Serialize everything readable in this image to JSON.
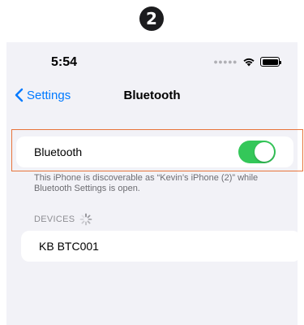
{
  "step_number": "2",
  "status_bar": {
    "time": "5:54",
    "signal_icon": "signal-dots-icon",
    "wifi_icon": "wifi-icon",
    "battery_icon": "battery-icon"
  },
  "nav": {
    "back_label": "Settings",
    "title": "Bluetooth"
  },
  "bluetooth": {
    "label": "Bluetooth",
    "toggle_on": true,
    "toggle_color": "#34c759"
  },
  "footnote": "This iPhone is discoverable as “Kevin’s iPhone (2)” while Bluetooth Settings is open.",
  "devices": {
    "header": "DEVICES",
    "items": [
      {
        "name": "KB BTC001"
      }
    ]
  },
  "colors": {
    "accent": "#007aff",
    "highlight": "#e8743b",
    "background": "#f2f2f7"
  }
}
